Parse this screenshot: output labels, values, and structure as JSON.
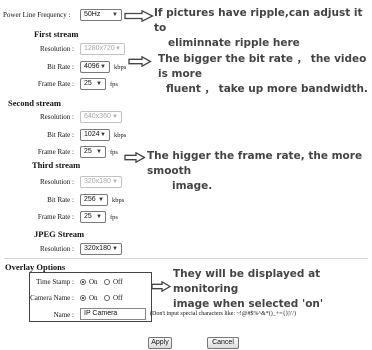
{
  "power_line": {
    "label": "Power Line Frequency :",
    "value": "50Hz"
  },
  "first_stream": {
    "title": "First stream",
    "resolution": {
      "label": "Resolution :",
      "value": "1280x720"
    },
    "bit_rate": {
      "label": "Bit Rate :",
      "value": "4096",
      "unit": "kbps"
    },
    "frame_rate": {
      "label": "Frame Rate :",
      "value": "25",
      "unit": "fps"
    }
  },
  "second_stream": {
    "title": "Second stream",
    "resolution": {
      "label": "Resolution :",
      "value": "640x360"
    },
    "bit_rate": {
      "label": "Bit Rate :",
      "value": "1024",
      "unit": "kbps"
    },
    "frame_rate": {
      "label": "Frame Rate :",
      "value": "25",
      "unit": "fps"
    }
  },
  "third_stream": {
    "title": "Third stream",
    "resolution": {
      "label": "Resolution :",
      "value": "320x180"
    },
    "bit_rate": {
      "label": "Bit Rate :",
      "value": "256",
      "unit": "kbps"
    },
    "frame_rate": {
      "label": "Frame Rate :",
      "value": "25",
      "unit": "fps"
    }
  },
  "jpeg_stream": {
    "title": "JPEG Stream",
    "resolution": {
      "label": "Resolution :",
      "value": "320x180"
    }
  },
  "overlay": {
    "title": "Overlay Options",
    "time_stamp": {
      "label": "Time Stamp :",
      "on": "On",
      "off": "Off",
      "selected": "On"
    },
    "camera_name": {
      "label": "Camera Name :",
      "on": "On",
      "off": "Off",
      "selected": "On"
    },
    "name": {
      "label": "Name :",
      "value": "IP Camera",
      "hint": "(Don't input special characters like: ~!@#$%^&*()_+={}|\\'/)"
    }
  },
  "buttons": {
    "apply": "Apply",
    "cancel": "Cancel"
  },
  "annotations": {
    "ripple_line1": "If pictures have ripple,can adjust it to",
    "ripple_line2": "eliminnate ripple here",
    "bitrate_line1": "The bigger the bit rate ， the video is more",
    "bitrate_line2": "fluent ， take up more bandwidth.",
    "framerate_line1": "The higger the frame rate, the more smooth",
    "framerate_line2": "image.",
    "overlay_line1": "They will be displayed at monitoring",
    "overlay_line2": "image when selected 'on'"
  },
  "icons": {
    "arrow": "right-arrow-icon",
    "dropdown": "chevron-down-icon"
  },
  "colors": {
    "annotation_text": "#444444",
    "frame_border": "#444444"
  }
}
